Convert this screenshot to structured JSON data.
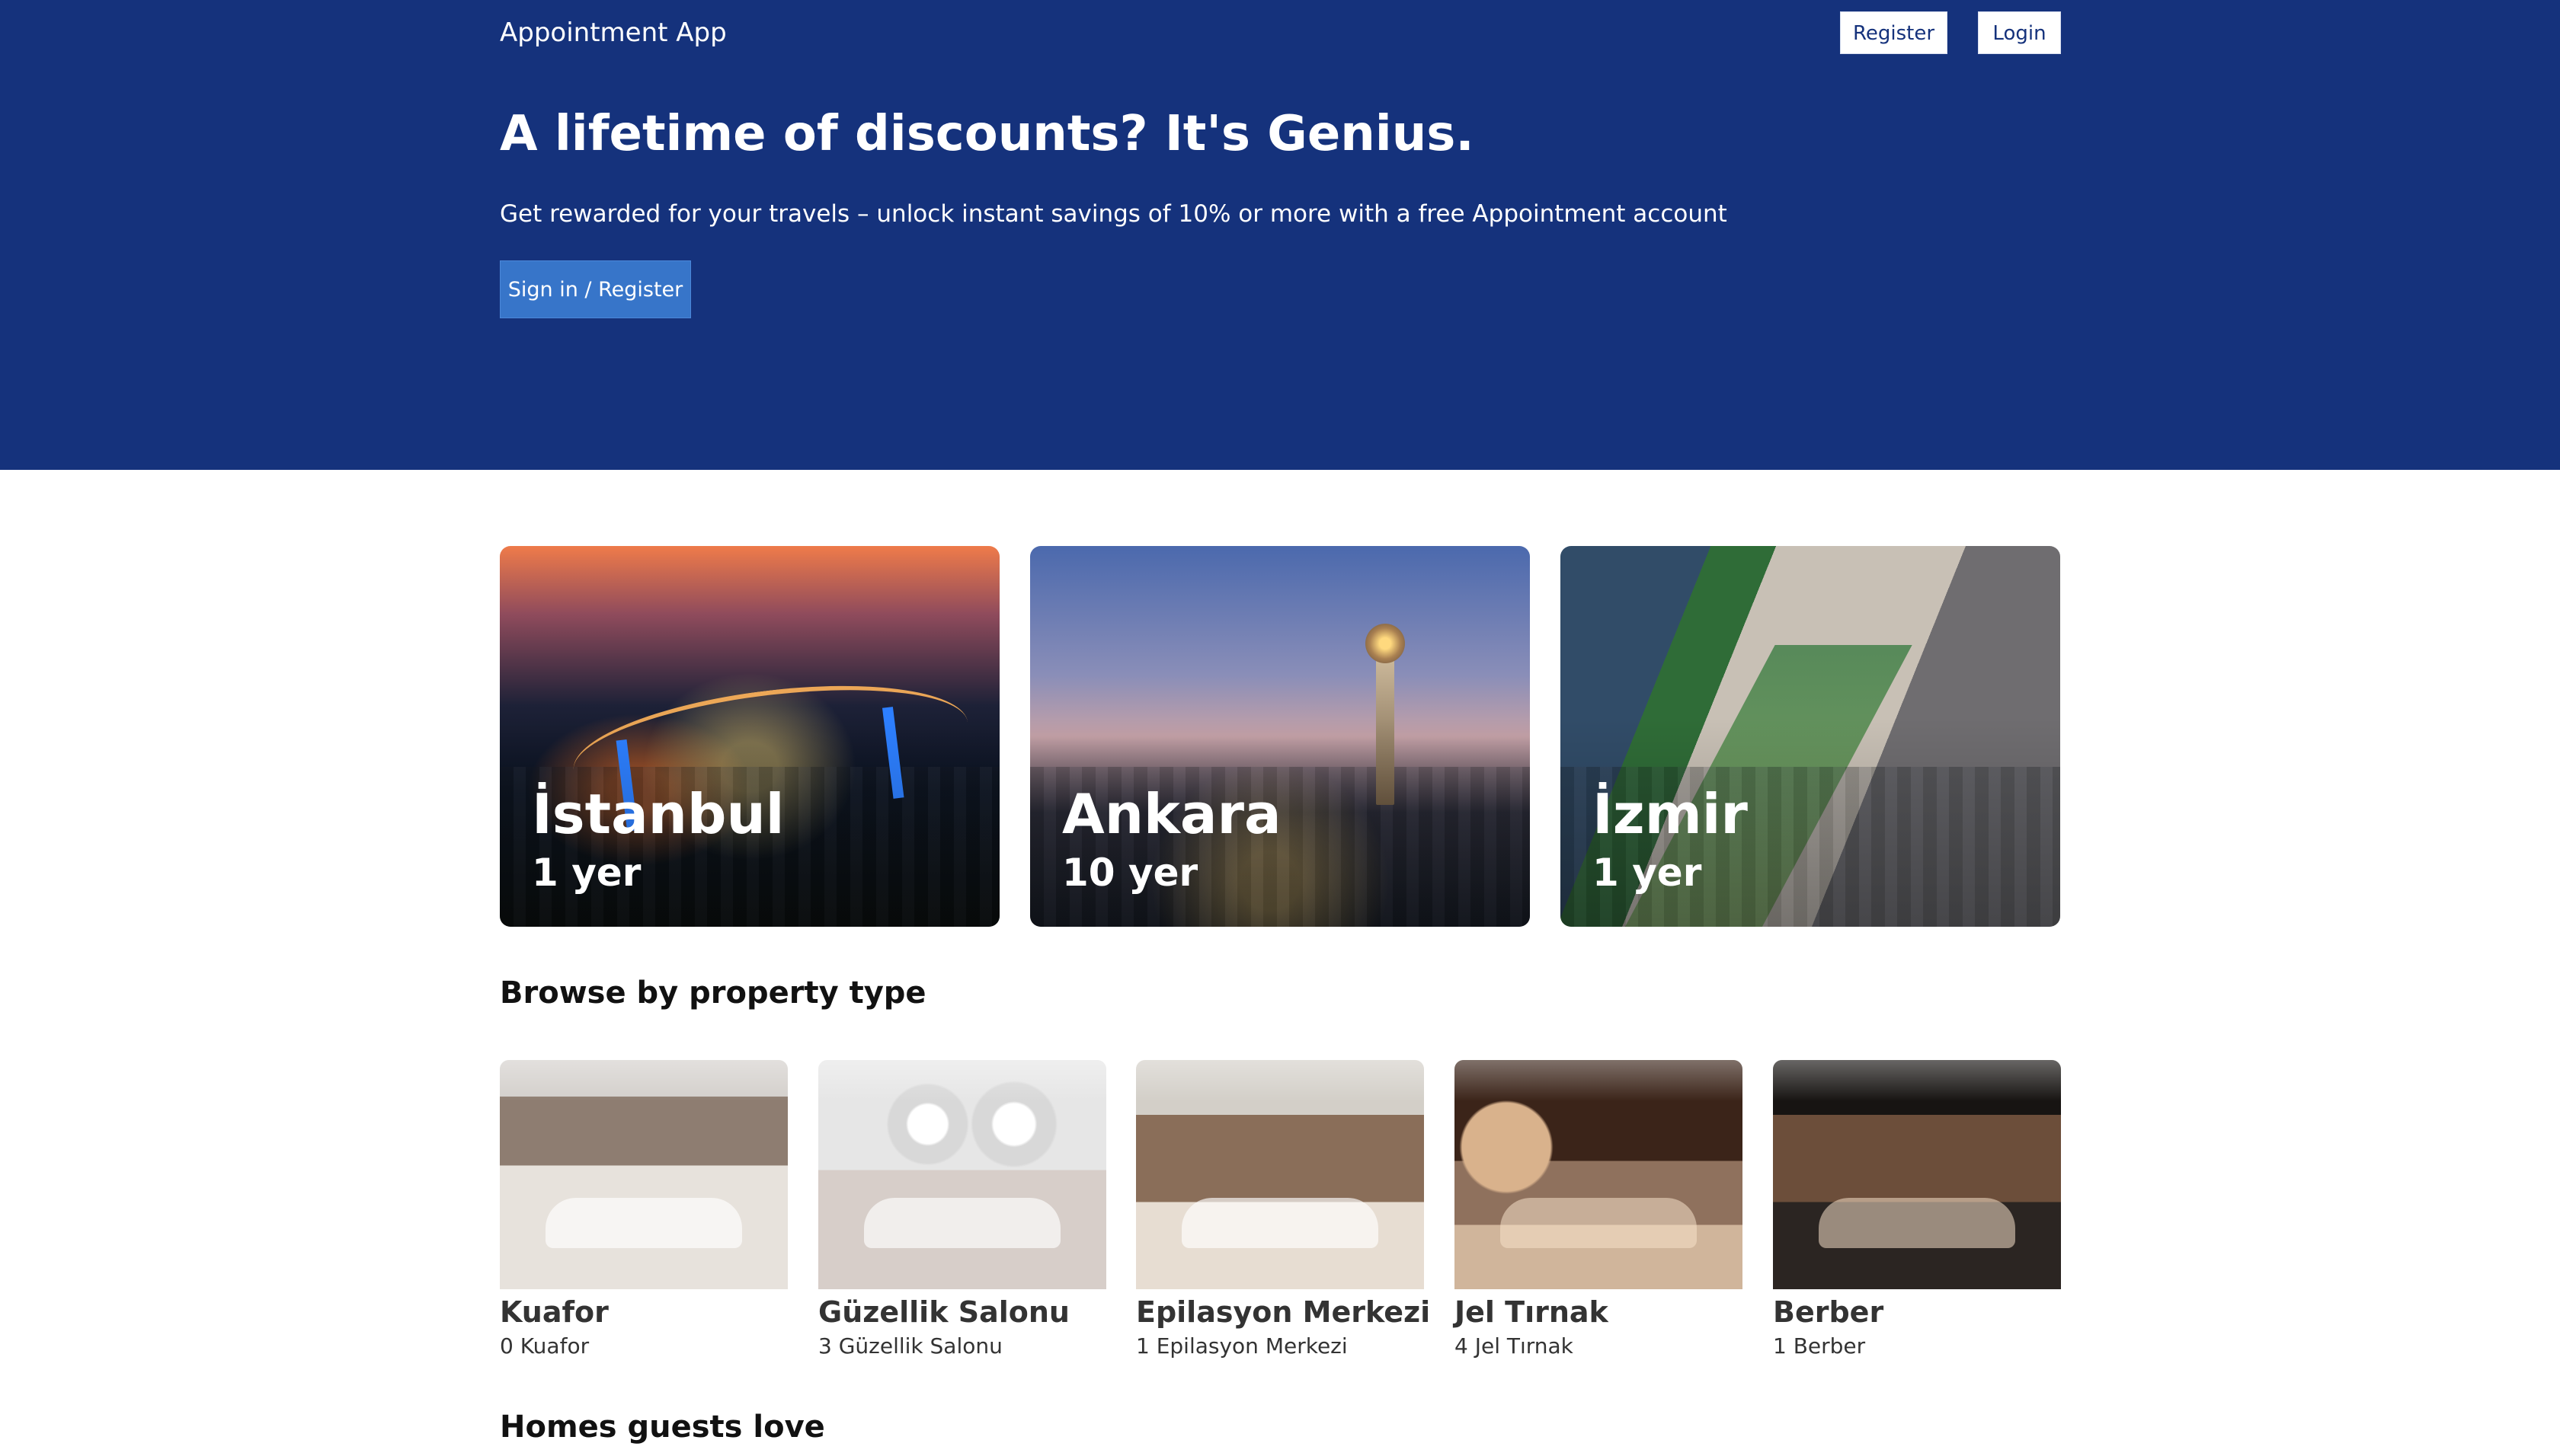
{
  "header": {
    "brand": "Appointment App",
    "register_label": "Register",
    "login_label": "Login"
  },
  "hero": {
    "headline": "A lifetime of discounts? It's Genius.",
    "subheadline": "Get rewarded for your travels – unlock instant savings of 10% or more with a free Appointment account",
    "cta_label": "Sign in / Register"
  },
  "cities": [
    {
      "name": "İstanbul",
      "count": "1 yer"
    },
    {
      "name": "Ankara",
      "count": "10 yer"
    },
    {
      "name": "İzmir",
      "count": "1 yer"
    }
  ],
  "sections": {
    "browse_title": "Browse by property type",
    "homes_title": "Homes guests love"
  },
  "property_types": [
    {
      "name": "Kuafor",
      "count": "0 Kuafor"
    },
    {
      "name": "Güzellik Salonu",
      "count": "3 Güzellik Salonu"
    },
    {
      "name": "Epilasyon Merkezi",
      "count": "1 Epilasyon Merkezi"
    },
    {
      "name": "Jel Tırnak",
      "count": "4 Jel Tırnak"
    },
    {
      "name": "Berber",
      "count": "1 Berber"
    }
  ]
}
